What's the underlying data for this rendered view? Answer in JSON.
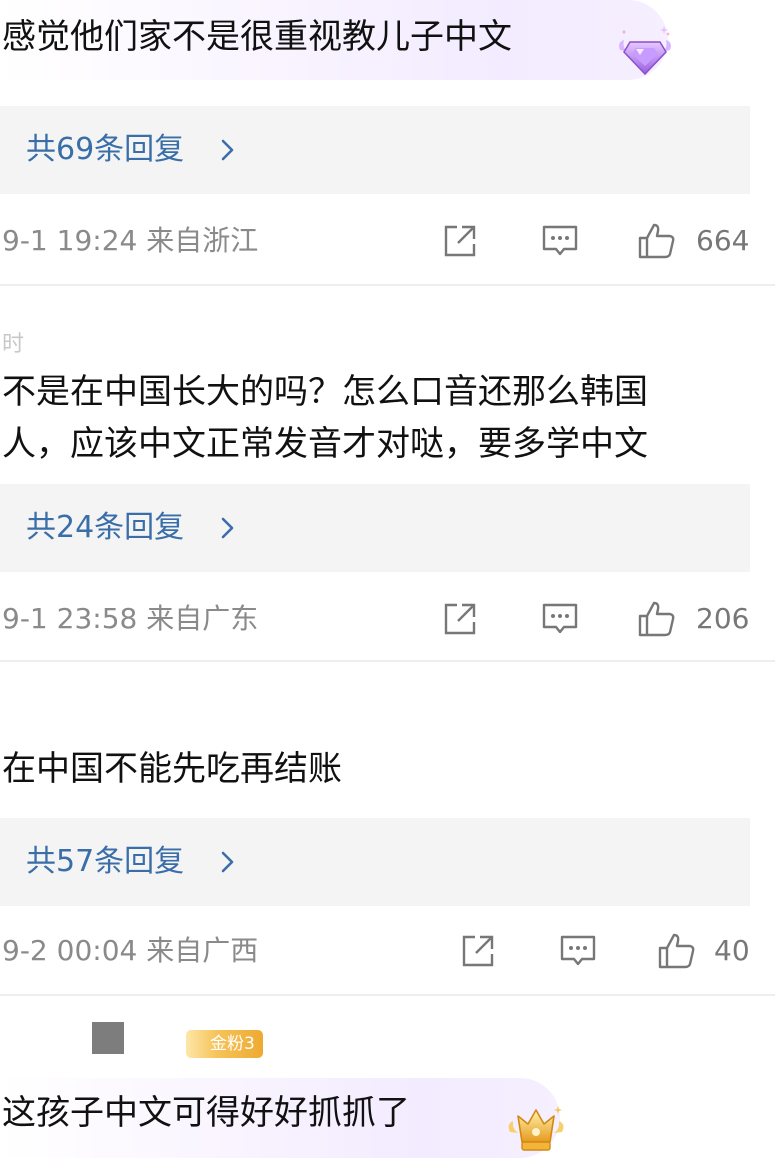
{
  "comments": [
    {
      "username": "",
      "text": "感觉他们家不是很重视教儿子中文",
      "badge_icon": "purple-gem-icon",
      "replies_label": "共69条回复",
      "meta": "9-1 19:24 来自浙江",
      "likes": "664"
    },
    {
      "username": "时",
      "text_lines": [
        "不是在中国长大的吗？怎么口音还那么韩国",
        "人，应该中文正常发音才对哒，要多学中文"
      ],
      "replies_label": "共24条回复",
      "meta": "9-1 23:58 来自广东",
      "likes": "206"
    },
    {
      "username": "",
      "text": "在中国不能先吃再结账",
      "replies_label": "共57条回复",
      "meta": "9-2 00:04 来自广西",
      "likes": "40"
    },
    {
      "username": "",
      "fan_badge": "金粉3",
      "text": "这孩子中文可得好好抓抓了",
      "badge_icon": "gold-crown-icon"
    }
  ],
  "colors": {
    "reply_link": "#3a6ea8",
    "meta_gray": "#8a8a8a",
    "reply_bg": "#f4f4f4",
    "divider": "#eeeeee",
    "fan_badge_gold": "#eeaa32",
    "gem_purple": "#b07ae8"
  }
}
